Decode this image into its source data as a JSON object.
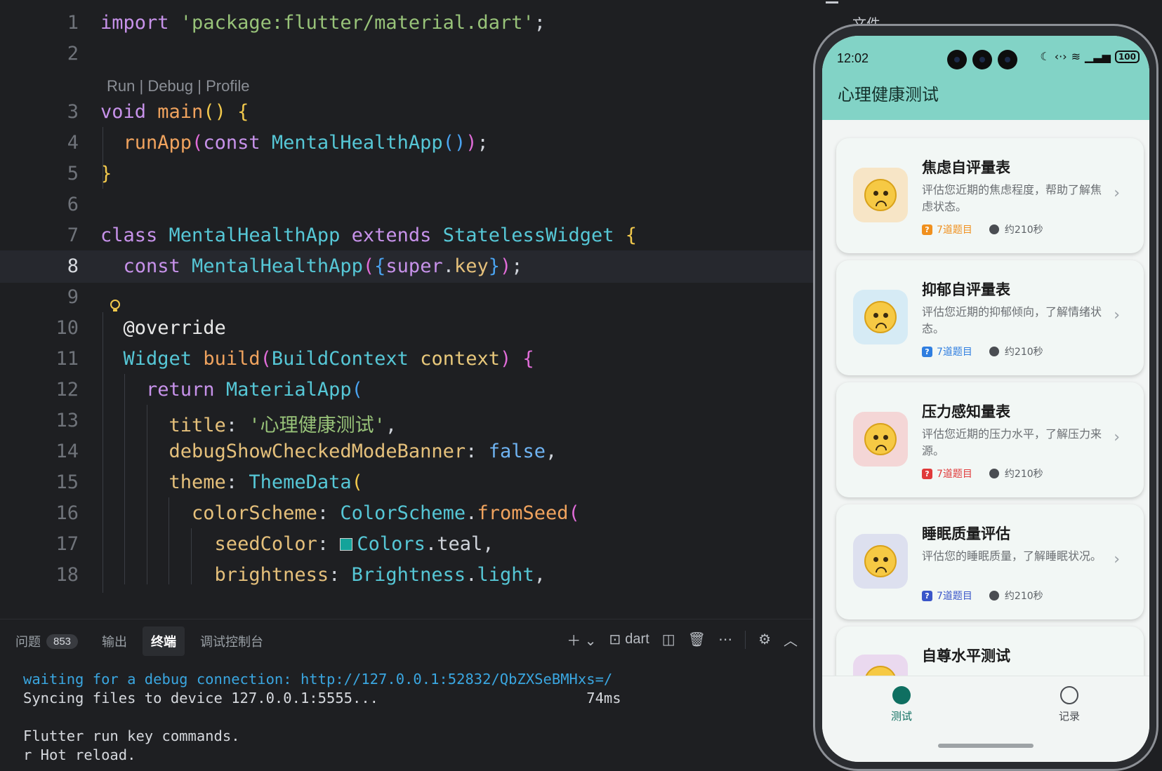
{
  "editor": {
    "codelens": [
      "Run",
      "Debug",
      "Profile"
    ],
    "lines": [
      {
        "num": "1",
        "segments": [
          [
            "kw",
            "import "
          ],
          [
            "str",
            "'package:flutter/material.dart'"
          ],
          [
            "punc",
            ";"
          ]
        ]
      },
      {
        "num": "2",
        "segments": []
      },
      {
        "num": "3",
        "segments": [
          [
            "kw",
            "void "
          ],
          [
            "fn",
            "main"
          ],
          [
            "brace1",
            "() {"
          ]
        ]
      },
      {
        "num": "4",
        "segments": [
          [
            "fn",
            "  runApp"
          ],
          [
            "brace2",
            "("
          ],
          [
            "kw",
            "const "
          ],
          [
            "cls",
            "MentalHealthApp"
          ],
          [
            "brace3",
            "()"
          ],
          [
            "brace2",
            ")"
          ],
          [
            "punc",
            ";"
          ]
        ]
      },
      {
        "num": "5",
        "segments": [
          [
            "brace1",
            "}"
          ]
        ]
      },
      {
        "num": "6",
        "segments": []
      },
      {
        "num": "7",
        "segments": [
          [
            "kw",
            "class "
          ],
          [
            "cls",
            "MentalHealthApp "
          ],
          [
            "kw",
            "extends "
          ],
          [
            "cls",
            "StatelessWidget "
          ],
          [
            "brace1",
            "{"
          ]
        ]
      },
      {
        "num": "8",
        "segments": [
          [
            "kw",
            "  const "
          ],
          [
            "cls",
            "MentalHealthApp"
          ],
          [
            "brace2",
            "("
          ],
          [
            "brace3",
            "{"
          ],
          [
            "kw",
            "super"
          ],
          [
            "punc",
            "."
          ],
          [
            "prop",
            "key"
          ],
          [
            "brace3",
            "}"
          ],
          [
            "brace2",
            ")"
          ],
          [
            "punc",
            ";"
          ]
        ]
      },
      {
        "num": "9",
        "segments": []
      },
      {
        "num": "10",
        "segments": [
          [
            "ann",
            "  @override"
          ]
        ]
      },
      {
        "num": "11",
        "segments": [
          [
            "cls",
            "  Widget "
          ],
          [
            "fn",
            "build"
          ],
          [
            "brace2",
            "("
          ],
          [
            "cls",
            "BuildContext "
          ],
          [
            "param",
            "context"
          ],
          [
            "brace2",
            ") "
          ],
          [
            "brace2",
            "{"
          ]
        ]
      },
      {
        "num": "12",
        "segments": [
          [
            "kw",
            "    return "
          ],
          [
            "cls",
            "MaterialApp"
          ],
          [
            "brace3",
            "("
          ]
        ]
      },
      {
        "num": "13",
        "segments": [
          [
            "prop",
            "      title"
          ],
          [
            "punc",
            ": "
          ],
          [
            "str",
            "'心理健康测试'"
          ],
          [
            "punc",
            ","
          ]
        ]
      },
      {
        "num": "14",
        "segments": [
          [
            "prop",
            "      debugShowCheckedModeBanner"
          ],
          [
            "punc",
            ": "
          ],
          [
            "bool",
            "false"
          ],
          [
            "punc",
            ","
          ]
        ]
      },
      {
        "num": "15",
        "segments": [
          [
            "prop",
            "      theme"
          ],
          [
            "punc",
            ": "
          ],
          [
            "cls",
            "ThemeData"
          ],
          [
            "brace1",
            "("
          ]
        ]
      },
      {
        "num": "16",
        "segments": [
          [
            "prop",
            "        colorScheme"
          ],
          [
            "punc",
            ": "
          ],
          [
            "cls",
            "ColorScheme"
          ],
          [
            "punc",
            "."
          ],
          [
            "fn",
            "fromSeed"
          ],
          [
            "brace2",
            "("
          ]
        ]
      },
      {
        "num": "17",
        "segments": [
          [
            "prop",
            "          seedColor"
          ],
          [
            "punc",
            ": "
          ],
          [
            "swatch",
            ""
          ],
          [
            "cls",
            "Colors"
          ],
          [
            "punc",
            "."
          ],
          [
            "punc",
            "teal"
          ],
          [
            "punc",
            ","
          ]
        ]
      },
      {
        "num": "18",
        "segments": [
          [
            "prop",
            "          brightness"
          ],
          [
            "punc",
            ": "
          ],
          [
            "cls",
            "Brightness"
          ],
          [
            "punc",
            "."
          ],
          [
            "cls",
            "light"
          ],
          [
            "punc",
            ","
          ]
        ]
      }
    ],
    "active_line": "8",
    "outline_header": "文件"
  },
  "panel": {
    "tabs": [
      {
        "label": "问题",
        "badge": "853"
      },
      {
        "label": "输出"
      },
      {
        "label": "终端",
        "active": true
      },
      {
        "label": "调试控制台"
      }
    ],
    "terminal_profile": "dart",
    "terminal_lines": [
      {
        "text": "waiting for a debug connection: http://127.0.0.1:52832/QbZXSeBMHxs=/",
        "color": "blue"
      },
      {
        "text": "Syncing files to device 127.0.0.1:5555...                        74ms"
      },
      {
        "text": ""
      },
      {
        "text": "Flutter run key commands."
      },
      {
        "text": "r Hot reload."
      }
    ]
  },
  "phone": {
    "status_time": "12:02",
    "battery": "100",
    "app_title": "心理健康测试",
    "cards": [
      {
        "title": "焦虑自评量表",
        "desc": "评估您近期的焦虑程度，帮助了解焦虑状态。",
        "questions": "7道题目",
        "time": "约210秒",
        "accent": "#f0901e",
        "bg": "#f7e5c6"
      },
      {
        "title": "抑郁自评量表",
        "desc": "评估您近期的抑郁倾向，了解情绪状态。",
        "questions": "7道题目",
        "time": "约210秒",
        "accent": "#2f7ee0",
        "bg": "#d6ebf5"
      },
      {
        "title": "压力感知量表",
        "desc": "评估您近期的压力水平，了解压力来源。",
        "questions": "7道题目",
        "time": "约210秒",
        "accent": "#e03a3a",
        "bg": "#f4d6d6"
      },
      {
        "title": "睡眠质量评估",
        "desc": "评估您的睡眠质量，了解睡眠状况。",
        "questions": "7道题目",
        "time": "约210秒",
        "accent": "#3a56c9",
        "bg": "#dde0ef"
      },
      {
        "title": "自尊水平测试",
        "desc": "",
        "questions": "",
        "time": "",
        "accent": "#9b59b6",
        "bg": "#ead9ef"
      }
    ],
    "nav": [
      {
        "label": "测试",
        "icon": "psychology-icon",
        "active": true
      },
      {
        "label": "记录",
        "icon": "history-icon",
        "active": false
      }
    ],
    "colors": {
      "appbar": "#82d3c6",
      "nav_active": "#0f6f61"
    }
  }
}
